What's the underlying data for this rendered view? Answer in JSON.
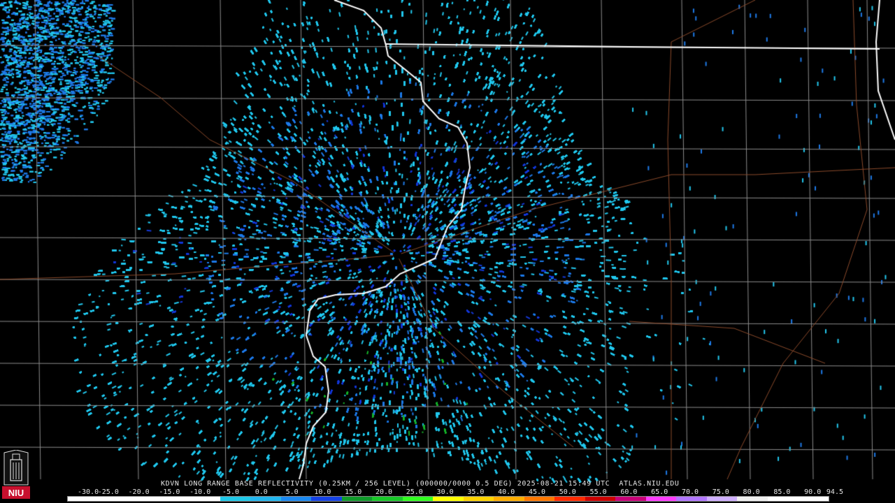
{
  "caption": "KDVN LONG RANGE BASE REFLECTIVITY (0.25KM / 256 LEVEL) (000000/0000 0.5 DEG) 2025-08-21 15:49 UTC  ATLAS.NIU.EDU",
  "scale": {
    "labels": [
      "-30.0",
      "-25.0",
      "-20.0",
      "-15.0",
      "-10.0",
      "-5.0",
      "0.0",
      "5.0",
      "10.0",
      "15.0",
      "20.0",
      "25.0",
      "30.0",
      "35.0",
      "40.0",
      "45.0",
      "50.0",
      "55.0",
      "60.0",
      "65.0",
      "70.0",
      "75.0",
      "80.0",
      "85.0",
      "90.0",
      "94.5"
    ],
    "colors": [
      "#ffffff",
      "#ffffff",
      "#ffffff",
      "#ffffff",
      "#ffffff",
      "#1fc8e8",
      "#22b6ee",
      "#1a88f0",
      "#1542e6",
      "#0f9a2a",
      "#18c828",
      "#31ff21",
      "#ffff00",
      "#ffd400",
      "#ffae00",
      "#ff7800",
      "#ff2b00",
      "#cc0000",
      "#c80078",
      "#ff3cff",
      "#b277ff",
      "#d0b0ff",
      "#f0f0f0",
      "#ffffff",
      "#ffffff"
    ]
  },
  "logo": {
    "text": "NIU"
  },
  "map": {
    "radar_site": "KDVN",
    "colors": {
      "state_border": "#ffffff",
      "county_line": "#8c8c8c",
      "highway": "#8b4a2b",
      "echo_light": "#22c8ee",
      "echo_mid": "#1e7ae8",
      "echo_dark": "#1438d8",
      "echo_green": "#16b22a"
    }
  }
}
